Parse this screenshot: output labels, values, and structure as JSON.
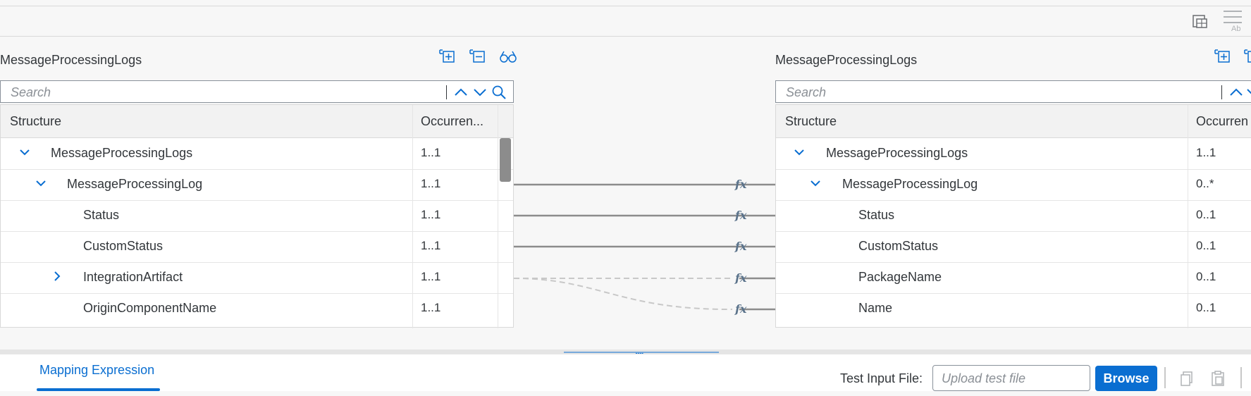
{
  "left_panel": {
    "title": "MessageProcessingLogs",
    "search_placeholder": "Search",
    "columns": [
      "Structure",
      "Occurren..."
    ],
    "rows": [
      {
        "name": "MessageProcessingLogs",
        "occurrence": "1..1"
      },
      {
        "name": "MessageProcessingLog",
        "occurrence": "1..1"
      },
      {
        "name": "Status",
        "occurrence": "1..1"
      },
      {
        "name": "CustomStatus",
        "occurrence": "1..1"
      },
      {
        "name": "IntegrationArtifact",
        "occurrence": "1..1"
      },
      {
        "name": "OriginComponentName",
        "occurrence": "1..1"
      }
    ]
  },
  "right_panel": {
    "title": "MessageProcessingLogs",
    "search_placeholder": "Search",
    "columns": [
      "Structure",
      "Occurren"
    ],
    "rows": [
      {
        "name": "MessageProcessingLogs",
        "occurrence": "1..1"
      },
      {
        "name": "MessageProcessingLog",
        "occurrence": "0..*"
      },
      {
        "name": "Status",
        "occurrence": "0..1"
      },
      {
        "name": "CustomStatus",
        "occurrence": "0..1"
      },
      {
        "name": "PackageName",
        "occurrence": "0..1"
      },
      {
        "name": "Name",
        "occurrence": "0..1"
      }
    ]
  },
  "function_marker": "fx",
  "splitter_grip": "....",
  "bottom": {
    "tab_label": "Mapping Expression",
    "test_input_label": "Test Input File:",
    "upload_placeholder": "Upload test file",
    "browse_label": "Browse"
  },
  "colors": {
    "accent": "#0a6ed1",
    "mapping_line": "#8c8c8c",
    "icon": "#0a6ed1"
  }
}
